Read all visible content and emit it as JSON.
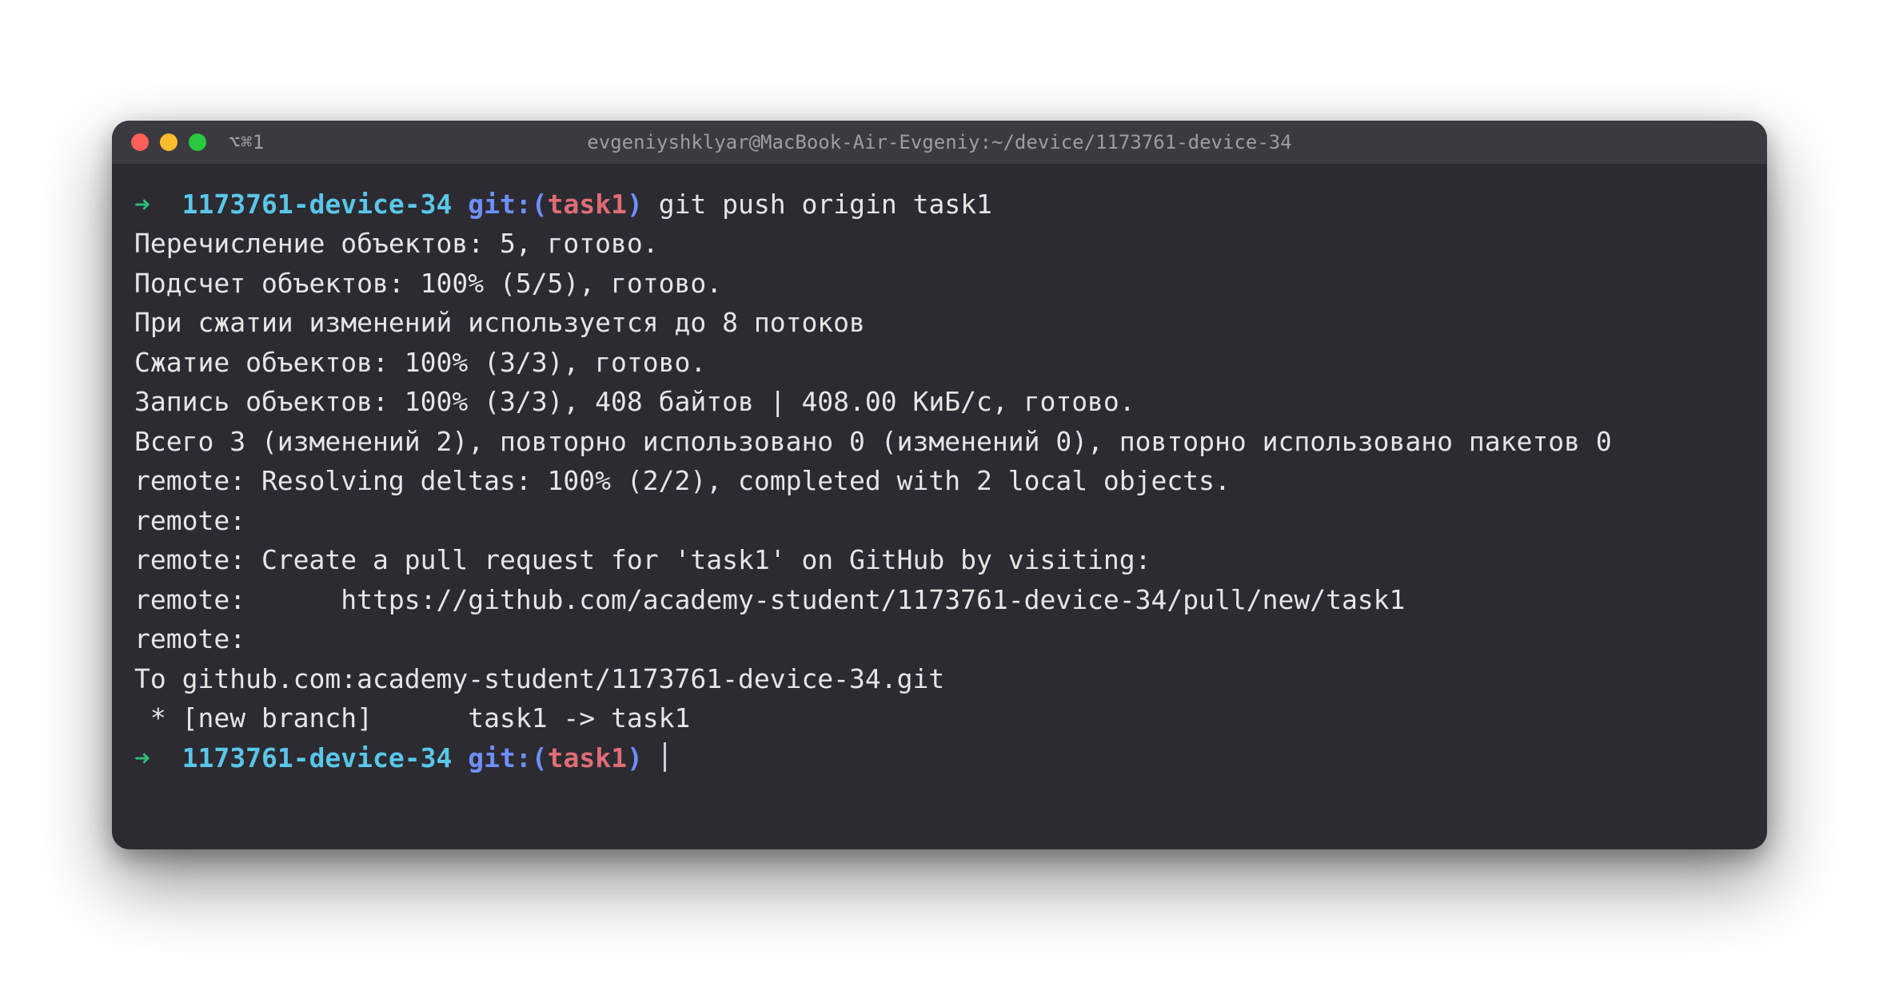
{
  "titlebar": {
    "tab_label": "⌥⌘1",
    "window_title": "evgeniyshklyar@MacBook-Air-Evgeniy:~/device/1173761-device-34"
  },
  "prompt1": {
    "arrow": "➜",
    "dir": "1173761-device-34",
    "git_prefix": "git:(",
    "branch": "task1",
    "git_suffix": ")",
    "command": "git push origin task1"
  },
  "output_lines": [
    "Перечисление объектов: 5, готово.",
    "Подсчет объектов: 100% (5/5), готово.",
    "При сжатии изменений используется до 8 потоков",
    "Сжатие объектов: 100% (3/3), готово.",
    "Запись объектов: 100% (3/3), 408 байтов | 408.00 КиБ/с, готово.",
    "Всего 3 (изменений 2), повторно использовано 0 (изменений 0), повторно использовано пакетов 0",
    "remote: Resolving deltas: 100% (2/2), completed with 2 local objects.",
    "remote:",
    "remote: Create a pull request for 'task1' on GitHub by visiting:",
    "remote:      https://github.com/academy-student/1173761-device-34/pull/new/task1",
    "remote:",
    "To github.com:academy-student/1173761-device-34.git",
    " * [new branch]      task1 -> task1"
  ],
  "prompt2": {
    "arrow": "➜",
    "dir": "1173761-device-34",
    "git_prefix": "git:(",
    "branch": "task1",
    "git_suffix": ")"
  }
}
